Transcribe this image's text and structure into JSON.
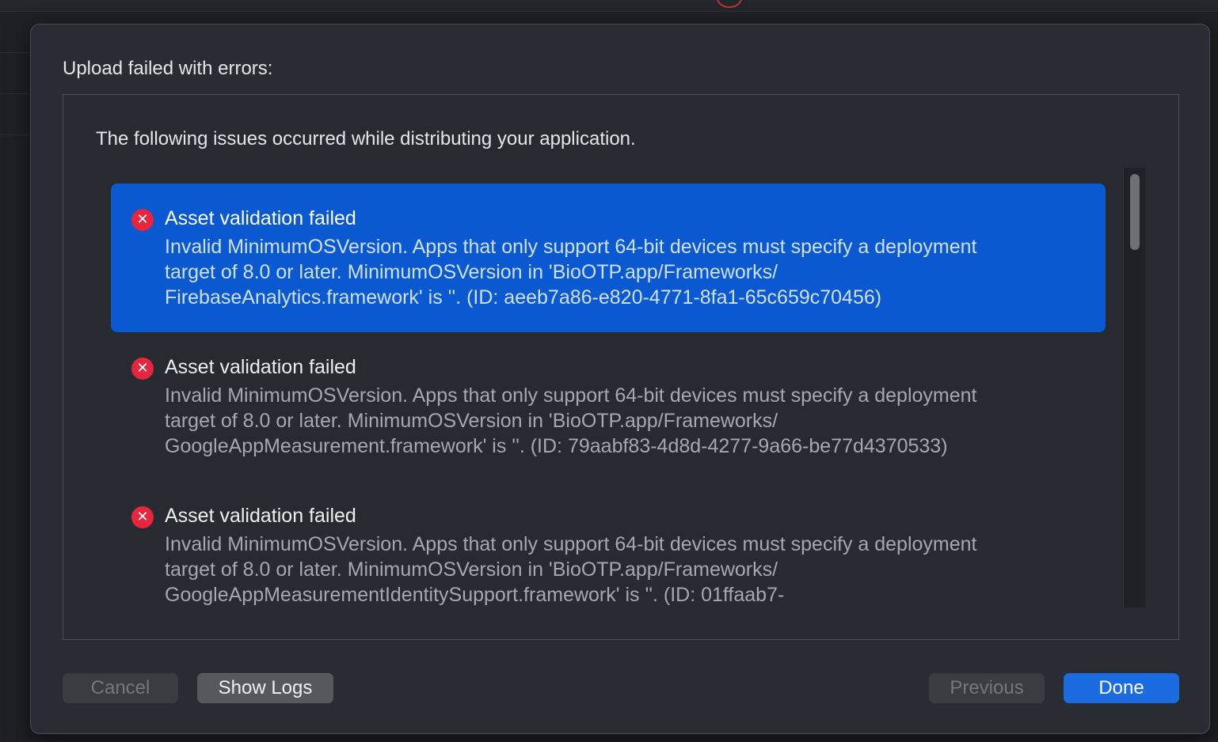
{
  "dialog": {
    "title": "Upload failed with errors:",
    "intro": "The following issues occurred while distributing your application."
  },
  "issues": [
    {
      "title": "Asset validation failed",
      "body": "Invalid MinimumOSVersion. Apps that only support 64-bit devices must specify a deployment\ntarget of 8.0 or later. MinimumOSVersion in 'BioOTP.app/Frameworks/\nFirebaseAnalytics.framework' is ''. (ID: aeeb7a86-e820-4771-8fa1-65c659c70456)",
      "selected": true,
      "icon": "error-x-icon"
    },
    {
      "title": "Asset validation failed",
      "body": "Invalid MinimumOSVersion. Apps that only support 64-bit devices must specify a deployment\ntarget of 8.0 or later. MinimumOSVersion in 'BioOTP.app/Frameworks/\nGoogleAppMeasurement.framework' is ''. (ID: 79aabf83-4d8d-4277-9a66-be77d4370533)",
      "selected": false,
      "icon": "error-x-icon"
    },
    {
      "title": "Asset validation failed",
      "body": "Invalid MinimumOSVersion. Apps that only support 64-bit devices must specify a deployment\ntarget of 8.0 or later. MinimumOSVersion in 'BioOTP.app/Frameworks/\nGoogleAppMeasurementIdentitySupport.framework' is ''. (ID: 01ffaab7-",
      "selected": false,
      "icon": "error-x-icon"
    }
  ],
  "buttons": {
    "cancel": "Cancel",
    "show_logs": "Show Logs",
    "previous": "Previous",
    "done": "Done"
  },
  "icons": {
    "error_glyph": "✕"
  },
  "colors": {
    "selection": "#0a59d0",
    "error_red": "#e5263d",
    "primary_button": "#1b6ce0"
  }
}
